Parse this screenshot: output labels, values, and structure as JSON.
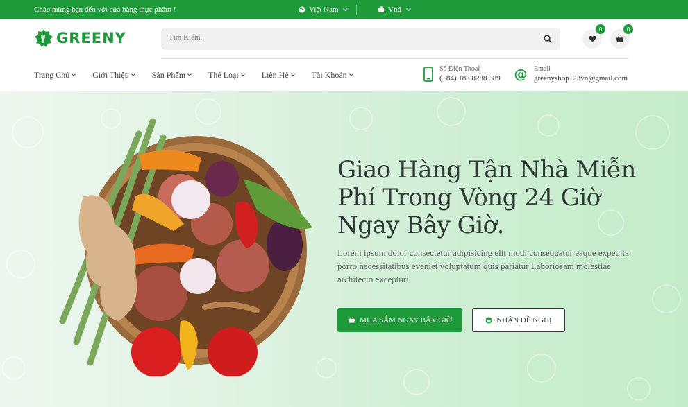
{
  "topbar": {
    "welcome": "Chào mừng bạn đến với cửa hàng thực phẩm !",
    "language": "Việt Nam",
    "currency": "Vnđ"
  },
  "header": {
    "logo_text": "GREENY",
    "search_placeholder": "Tìm Kiếm...",
    "wishlist_count": "0",
    "cart_count": "0"
  },
  "nav": {
    "items": [
      {
        "label": "Trang Chủ"
      },
      {
        "label": "Giới Thiệu"
      },
      {
        "label": "Sản Phẩm"
      },
      {
        "label": "Thể Loại"
      },
      {
        "label": "Liên Hệ"
      },
      {
        "label": "Tài Khoản"
      }
    ]
  },
  "contact": {
    "phone_label": "Số Điện Thoại",
    "phone": "(+84) 183 8288 389",
    "email_label": "Email",
    "email": "greenyshop123vn@gmail.com"
  },
  "hero": {
    "title": "Giao Hàng Tận Nhà Miễn Phí Trong Vòng 24 Giờ Ngay Bây Giờ.",
    "text": "Lorem ipsum dolor consectetur adipisicing elit modi consequatur eaque expedita porro necessitatibus eveniet voluptatum quis pariatur Laboriosam molestiae architecto excepturi",
    "shop_button": "MUA SẮM NGAY BÂY GIỜ",
    "offer_button": "NHẬN ĐỀ NGHỊ"
  },
  "colors": {
    "brand": "#1f9a3b",
    "hero_bg": "#d6f0da"
  },
  "icons": [
    "globe-icon",
    "currency-icon",
    "search-icon",
    "heart-icon",
    "cart-icon",
    "phone-icon",
    "at-icon",
    "basket-icon",
    "gift-icon"
  ]
}
